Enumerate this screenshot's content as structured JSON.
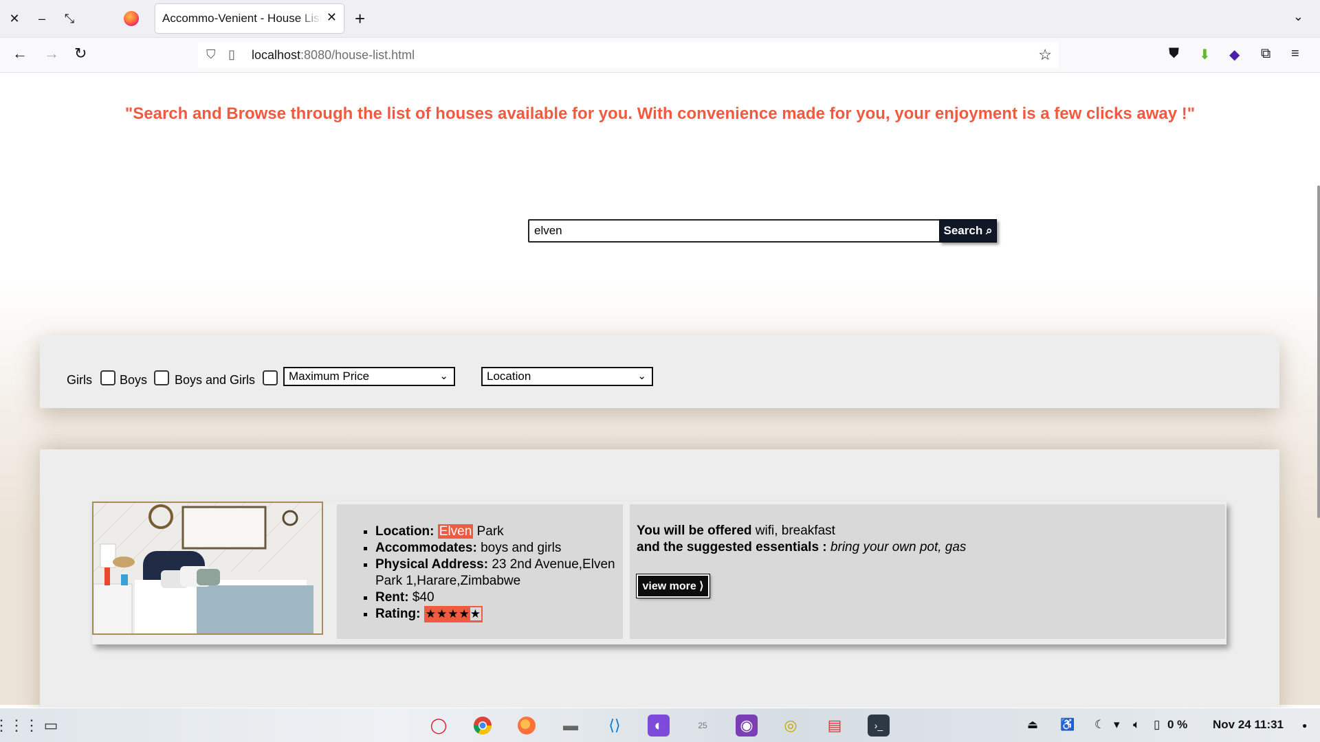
{
  "browser": {
    "tab_title": "Accommo-Venient - House Listings",
    "url_host": "localhost",
    "url_rest": ":8080/house-list.html",
    "icons": [
      "close-icon",
      "minimize-icon",
      "restore-icon",
      "firefox-icon",
      "tab-close-icon",
      "new-tab-icon",
      "tab-list-icon",
      "back-icon",
      "forward-icon",
      "reload-icon",
      "shield-icon",
      "page-icon",
      "bookmark-star-icon",
      "pocket-icon",
      "download-icon",
      "extension-icon",
      "puzzle-icon",
      "menu-icon"
    ]
  },
  "page": {
    "tagline": "\"Search and Browse through the list of houses available for you. With convenience made for you, your enjoyment is a few clicks away !\"",
    "search": {
      "value": "elven",
      "button_label": "Search ⌕"
    },
    "filters": {
      "girls_label": "Girls",
      "boys_label": "Boys",
      "boys_and_girls_label": "Boys and Girls",
      "max_price_select": "Maximum Price",
      "location_select": "Location"
    },
    "listing": {
      "location_label": "Location:",
      "location_highlight": "Elven",
      "location_rest": " Park",
      "accommodates_label": "Accommodates:",
      "accommodates_value": "boys and girls",
      "address_label": "Physical Address:",
      "address_value": "23 2nd Avenue,Elven Park 1,Harare,Zimbabwe",
      "rent_label": "Rent:",
      "rent_value": "$40",
      "rating_label": "Rating:",
      "rating_stars": 4,
      "rating_max": 5,
      "offered_label": "You will be offered",
      "offered_value": "wifi, breakfast",
      "essentials_label": "and the suggested essentials :",
      "essentials_value": "bring your own pot, gas",
      "view_more_label": "view more ⟩"
    }
  },
  "taskbar": {
    "apps": [
      "opera-icon",
      "chrome-icon",
      "firefox-icon",
      "files-icon",
      "vscode-icon",
      "tor-icon",
      "calendar-icon",
      "github-icon",
      "rhythmbox-icon",
      "text-editor-icon",
      "terminal-icon"
    ],
    "battery": "0 %",
    "clock": "Nov 24  11:31"
  }
}
